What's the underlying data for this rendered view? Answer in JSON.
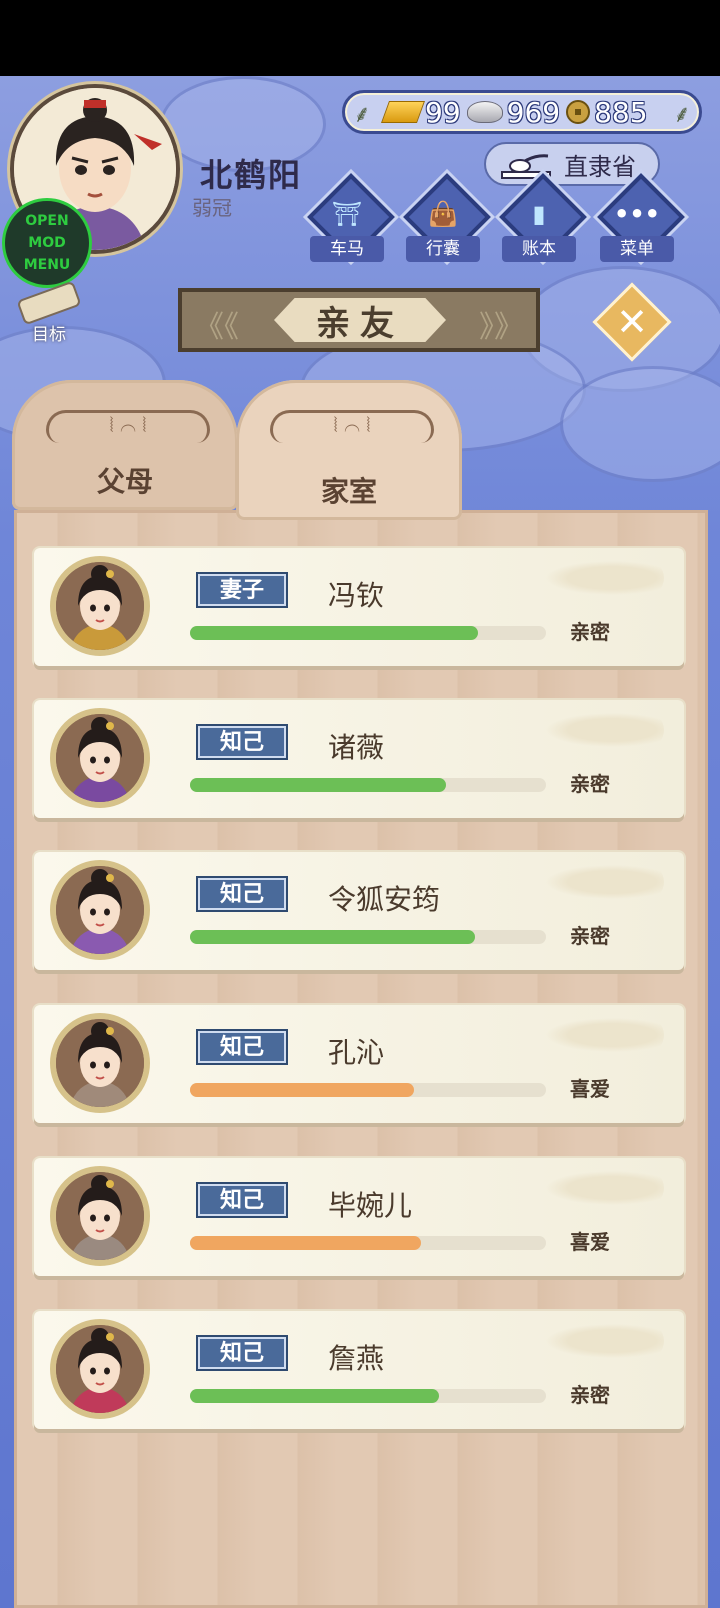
{
  "player": {
    "name": "北鹤阳",
    "rank": "弱冠"
  },
  "mod_menu": {
    "line1": "OPEN",
    "line2": "MOD MENU"
  },
  "goal_label": "目标",
  "currency": {
    "gold": "99",
    "silver": "969",
    "coins": "885"
  },
  "location": "直隶省",
  "nav": [
    {
      "label": "车马",
      "icon": "carriage-icon"
    },
    {
      "label": "行囊",
      "icon": "bag-icon"
    },
    {
      "label": "账本",
      "icon": "ledger-icon"
    },
    {
      "label": "菜单",
      "icon": "more-icon"
    }
  ],
  "title": "亲友",
  "tabs": [
    {
      "label": "父母",
      "active": false
    },
    {
      "label": "家室",
      "active": true
    }
  ],
  "members": [
    {
      "relation": "妻子",
      "name": "冯钦",
      "status": "亲密",
      "level": 0.81,
      "color": "#6cbf56"
    },
    {
      "relation": "知己",
      "name": "诸薇",
      "status": "亲密",
      "level": 0.72,
      "color": "#6cbf56"
    },
    {
      "relation": "知己",
      "name": "令狐安筠",
      "status": "亲密",
      "level": 0.8,
      "color": "#6cbf56"
    },
    {
      "relation": "知己",
      "name": "孔沁",
      "status": "喜爱",
      "level": 0.63,
      "color": "#f0a660"
    },
    {
      "relation": "知己",
      "name": "毕婉儿",
      "status": "喜爱",
      "level": 0.65,
      "color": "#f0a660"
    },
    {
      "relation": "知己",
      "name": "詹燕",
      "status": "亲密",
      "level": 0.7,
      "color": "#6cbf56"
    }
  ]
}
